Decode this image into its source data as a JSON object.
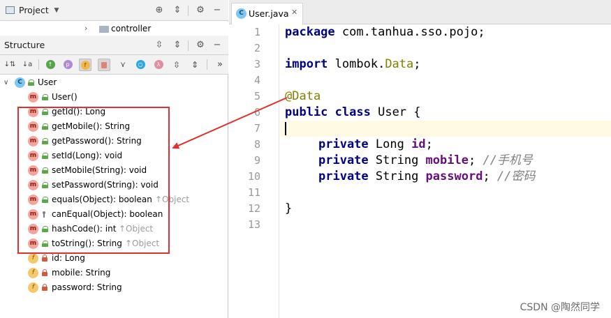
{
  "project_header": {
    "title": "Project"
  },
  "path_row": {
    "folder": "controller"
  },
  "structure_header": {
    "title": "Structure"
  },
  "structure_toolbar": {
    "buttons": [
      "sort-by-visibility",
      "sort-alphabetically",
      "show-inherited",
      "show-properties",
      "show-fields",
      "show-non-public",
      "show-lambdas",
      "show-anonymous",
      "show-lambda",
      "expand-all",
      "collapse-all",
      "more"
    ],
    "letters": {
      "p": "p",
      "f": "f",
      "lambda": "λ",
      "more": "»"
    }
  },
  "tree": {
    "class_label": "User",
    "members": [
      {
        "kind": "m",
        "vis": "pub",
        "label": "User()",
        "inherited": ""
      },
      {
        "kind": "m",
        "vis": "pub",
        "label": "getId(): Long",
        "inherited": ""
      },
      {
        "kind": "m",
        "vis": "pub",
        "label": "getMobile(): String",
        "inherited": ""
      },
      {
        "kind": "m",
        "vis": "pub",
        "label": "getPassword(): String",
        "inherited": ""
      },
      {
        "kind": "m",
        "vis": "pub",
        "label": "setId(Long): void",
        "inherited": ""
      },
      {
        "kind": "m",
        "vis": "pub",
        "label": "setMobile(String): void",
        "inherited": ""
      },
      {
        "kind": "m",
        "vis": "pub",
        "label": "setPassword(String): void",
        "inherited": ""
      },
      {
        "kind": "m",
        "vis": "pub",
        "label": "equals(Object): boolean",
        "inherited": "↑Object"
      },
      {
        "kind": "m",
        "vis": "prot",
        "label": "canEqual(Object): boolean",
        "inherited": ""
      },
      {
        "kind": "m",
        "vis": "pub",
        "label": "hashCode(): int",
        "inherited": "↑Object"
      },
      {
        "kind": "m",
        "vis": "pub",
        "label": "toString(): String",
        "inherited": "↑Object"
      },
      {
        "kind": "f",
        "vis": "priv",
        "label": "id: Long",
        "inherited": ""
      },
      {
        "kind": "f",
        "vis": "priv",
        "label": "mobile: String",
        "inherited": ""
      },
      {
        "kind": "f",
        "vis": "priv",
        "label": "password: String",
        "inherited": ""
      }
    ]
  },
  "editor": {
    "tab_label": "User.java",
    "line_numbers": [
      "1",
      "2",
      "3",
      "4",
      "5",
      "6",
      "7",
      "8",
      "9",
      "10",
      "11",
      "12",
      "13"
    ],
    "lines": {
      "l1": {
        "kw": "package",
        "rest": " com.tanhua.sso.pojo;"
      },
      "l3": {
        "kw": "import",
        "rest_a": " lombok.",
        "cls": "Data",
        "rest_b": ";"
      },
      "l5": {
        "ann": "@Data"
      },
      "l6": {
        "kw1": "public",
        "kw2": "class",
        "rest": " User {"
      },
      "l8": {
        "kw": "private",
        "type": " Long ",
        "fld": "id",
        "rest": ";"
      },
      "l9": {
        "kw": "private",
        "type": " String ",
        "fld": "mobile",
        "rest": "; ",
        "cm": "//手机号"
      },
      "l10": {
        "kw": "private",
        "type": " String ",
        "fld": "password",
        "rest": "; ",
        "cm": "//密码"
      },
      "l12": {
        "rest": "}"
      }
    }
  },
  "watermark": "CSDN @陶然同学",
  "colors": {
    "annotation_box": "#e23030",
    "arrow": "#e23030",
    "keyword": "#000080",
    "field": "#660e7a"
  }
}
